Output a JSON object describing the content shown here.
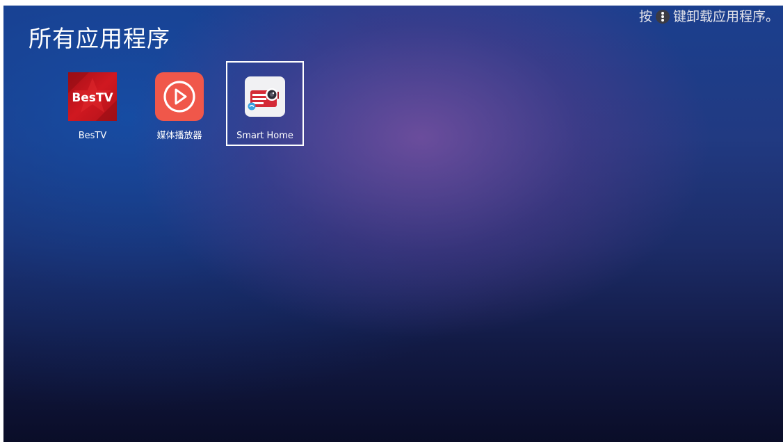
{
  "page": {
    "title": "所有应用程序"
  },
  "hint": {
    "prefix": "按",
    "key_icon": "three-dot-menu-icon",
    "suffix": "键卸载应用程序。"
  },
  "apps": [
    {
      "label": "BesTV",
      "icon": "bestv-logo-icon",
      "logo_text": "BesTV",
      "focused": false
    },
    {
      "label": "媒体播放器",
      "icon": "play-circle-icon",
      "focused": false
    },
    {
      "label": "Smart Home",
      "icon": "projector-icon",
      "focused": true
    }
  ],
  "colors": {
    "bestv_red": "#c8141e",
    "media_player_orange": "#f0574a",
    "focus_border": "#ffffff",
    "text": "#ffffff"
  }
}
